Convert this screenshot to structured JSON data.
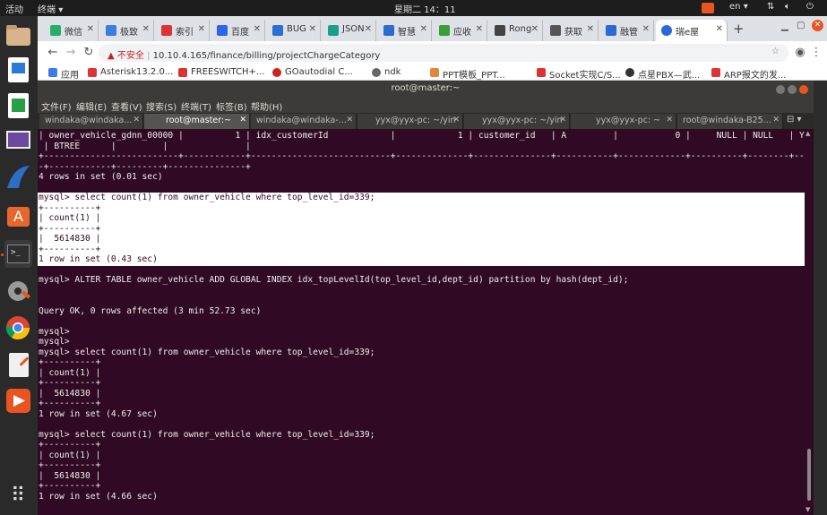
{
  "top_panel": {
    "activities": "活动",
    "app_name": "终端",
    "app_arrow": "▾",
    "clock": "星期二 14：11",
    "lang": "en",
    "lang_arrow": "▾"
  },
  "browser": {
    "tabs": [
      {
        "label": "微信",
        "color": "#2aae67"
      },
      {
        "label": "极致",
        "color": "#3b7de0"
      },
      {
        "label": "索引",
        "color": "#d33"
      },
      {
        "label": "百度",
        "color": "#2f64e6"
      },
      {
        "label": "BUG",
        "color": "#2a6fd6"
      },
      {
        "label": "JSON",
        "color": "#19a08a"
      },
      {
        "label": "智慧",
        "color": "#2d6bd0"
      },
      {
        "label": "应收",
        "color": "#3a9c3a"
      },
      {
        "label": "Rong",
        "color": "#444"
      },
      {
        "label": "获取",
        "color": "#555"
      },
      {
        "label": "融管",
        "color": "#2b6ad6"
      },
      {
        "label": "瑞e屋",
        "color": "#2b6ad6"
      }
    ],
    "new_tab": "+",
    "insecure_label": "不安全",
    "url": "10.10.4.165/finance/billing/projectChargeCategory",
    "bookmarks": [
      {
        "label": "应用",
        "color": "#3e7be6"
      },
      {
        "label": "Asterisk13.2.0...",
        "color": "#d33"
      },
      {
        "label": "FREESWITCH+...",
        "color": "#d33"
      },
      {
        "label": "GOautodial C...",
        "color": "#c22"
      },
      {
        "label": "ndk",
        "color": "#666"
      },
      {
        "label": "PPT模板_PPT...",
        "color": "#e0883a"
      },
      {
        "label": "Socket实现C/S...",
        "color": "#d33"
      },
      {
        "label": "点星PBX—武...",
        "color": "#333"
      },
      {
        "label": "ARP报文的发...",
        "color": "#d33"
      }
    ]
  },
  "terminal": {
    "title": "root@master:~",
    "menu": [
      "文件(F)",
      "编辑(E)",
      "查看(V)",
      "搜索(S)",
      "终端(T)",
      "标签(B)",
      "帮助(H)"
    ],
    "tabs": [
      {
        "label": "windaka@windaka..."
      },
      {
        "label": "root@master:~"
      },
      {
        "label": "windaka@windaka-..."
      },
      {
        "label": "yyx@yyx-pc: ~/yin"
      },
      {
        "label": "yyx@yyx-pc: ~/yin"
      },
      {
        "label": "yyx@yyx-pc: ~"
      },
      {
        "label": "root@windaka-B25..."
      }
    ],
    "lines": [
      "| owner_vehicle_gdnn_00000 |          1 | idx_customerId            |            1 | customer_id   | A         |           0 |     NULL | NULL   | YES",
      " | BTREE      |         |               |",
      "+--------------------------+------------+---------------------------+--------------+---------------+-----------+-------------+----------+--------+-----",
      "-+------------+---------+---------------+",
      "4 rows in set (0.01 sec)",
      "",
      "mysql> select count(1) from owner_vehicle where top_level_id=339;",
      "+----------+",
      "| count(1) |",
      "+----------+",
      "|  5614830 |",
      "+----------+",
      "1 row in set (0.43 sec)",
      "",
      "mysql> ALTER TABLE owner_vehicle ADD GLOBAL INDEX idx_topLevelId(top_level_id,dept_id) partition by hash(dept_id);",
      "",
      "",
      "Query OK, 0 rows affected (3 min 52.73 sec)",
      "",
      "mysql>",
      "mysql>",
      "mysql> select count(1) from owner_vehicle where top_level_id=339;",
      "+----------+",
      "| count(1) |",
      "+----------+",
      "|  5614830 |",
      "+----------+",
      "1 row in set (4.67 sec)",
      "",
      "mysql> select count(1) from owner_vehicle where top_level_id=339;",
      "+----------+",
      "| count(1) |",
      "+----------+",
      "|  5614830 |",
      "+----------+",
      "1 row in set (4.66 sec)",
      ""
    ]
  },
  "dock": {
    "items": [
      {
        "icon": "files-icon",
        "color": "#d9b38c"
      },
      {
        "icon": "writer-icon",
        "color": "#2a7ad8"
      },
      {
        "icon": "calc-icon",
        "color": "#27a045"
      },
      {
        "icon": "remote-desktop-icon",
        "color": "#6b4aa0"
      },
      {
        "icon": "wireshark-icon",
        "color": "#2c6ec6"
      },
      {
        "icon": "software-center-icon",
        "color": "#e8652e"
      },
      {
        "icon": "terminal-icon",
        "color": "#2e2e2e"
      },
      {
        "icon": "settings-icon",
        "color": "#9a9a9a"
      },
      {
        "icon": "chrome-icon",
        "color": "#db4437"
      },
      {
        "icon": "text-editor-icon",
        "color": "#f0f0f0"
      },
      {
        "icon": "media-player-icon",
        "color": "#e95420"
      }
    ],
    "apps_grid": "⠿"
  }
}
